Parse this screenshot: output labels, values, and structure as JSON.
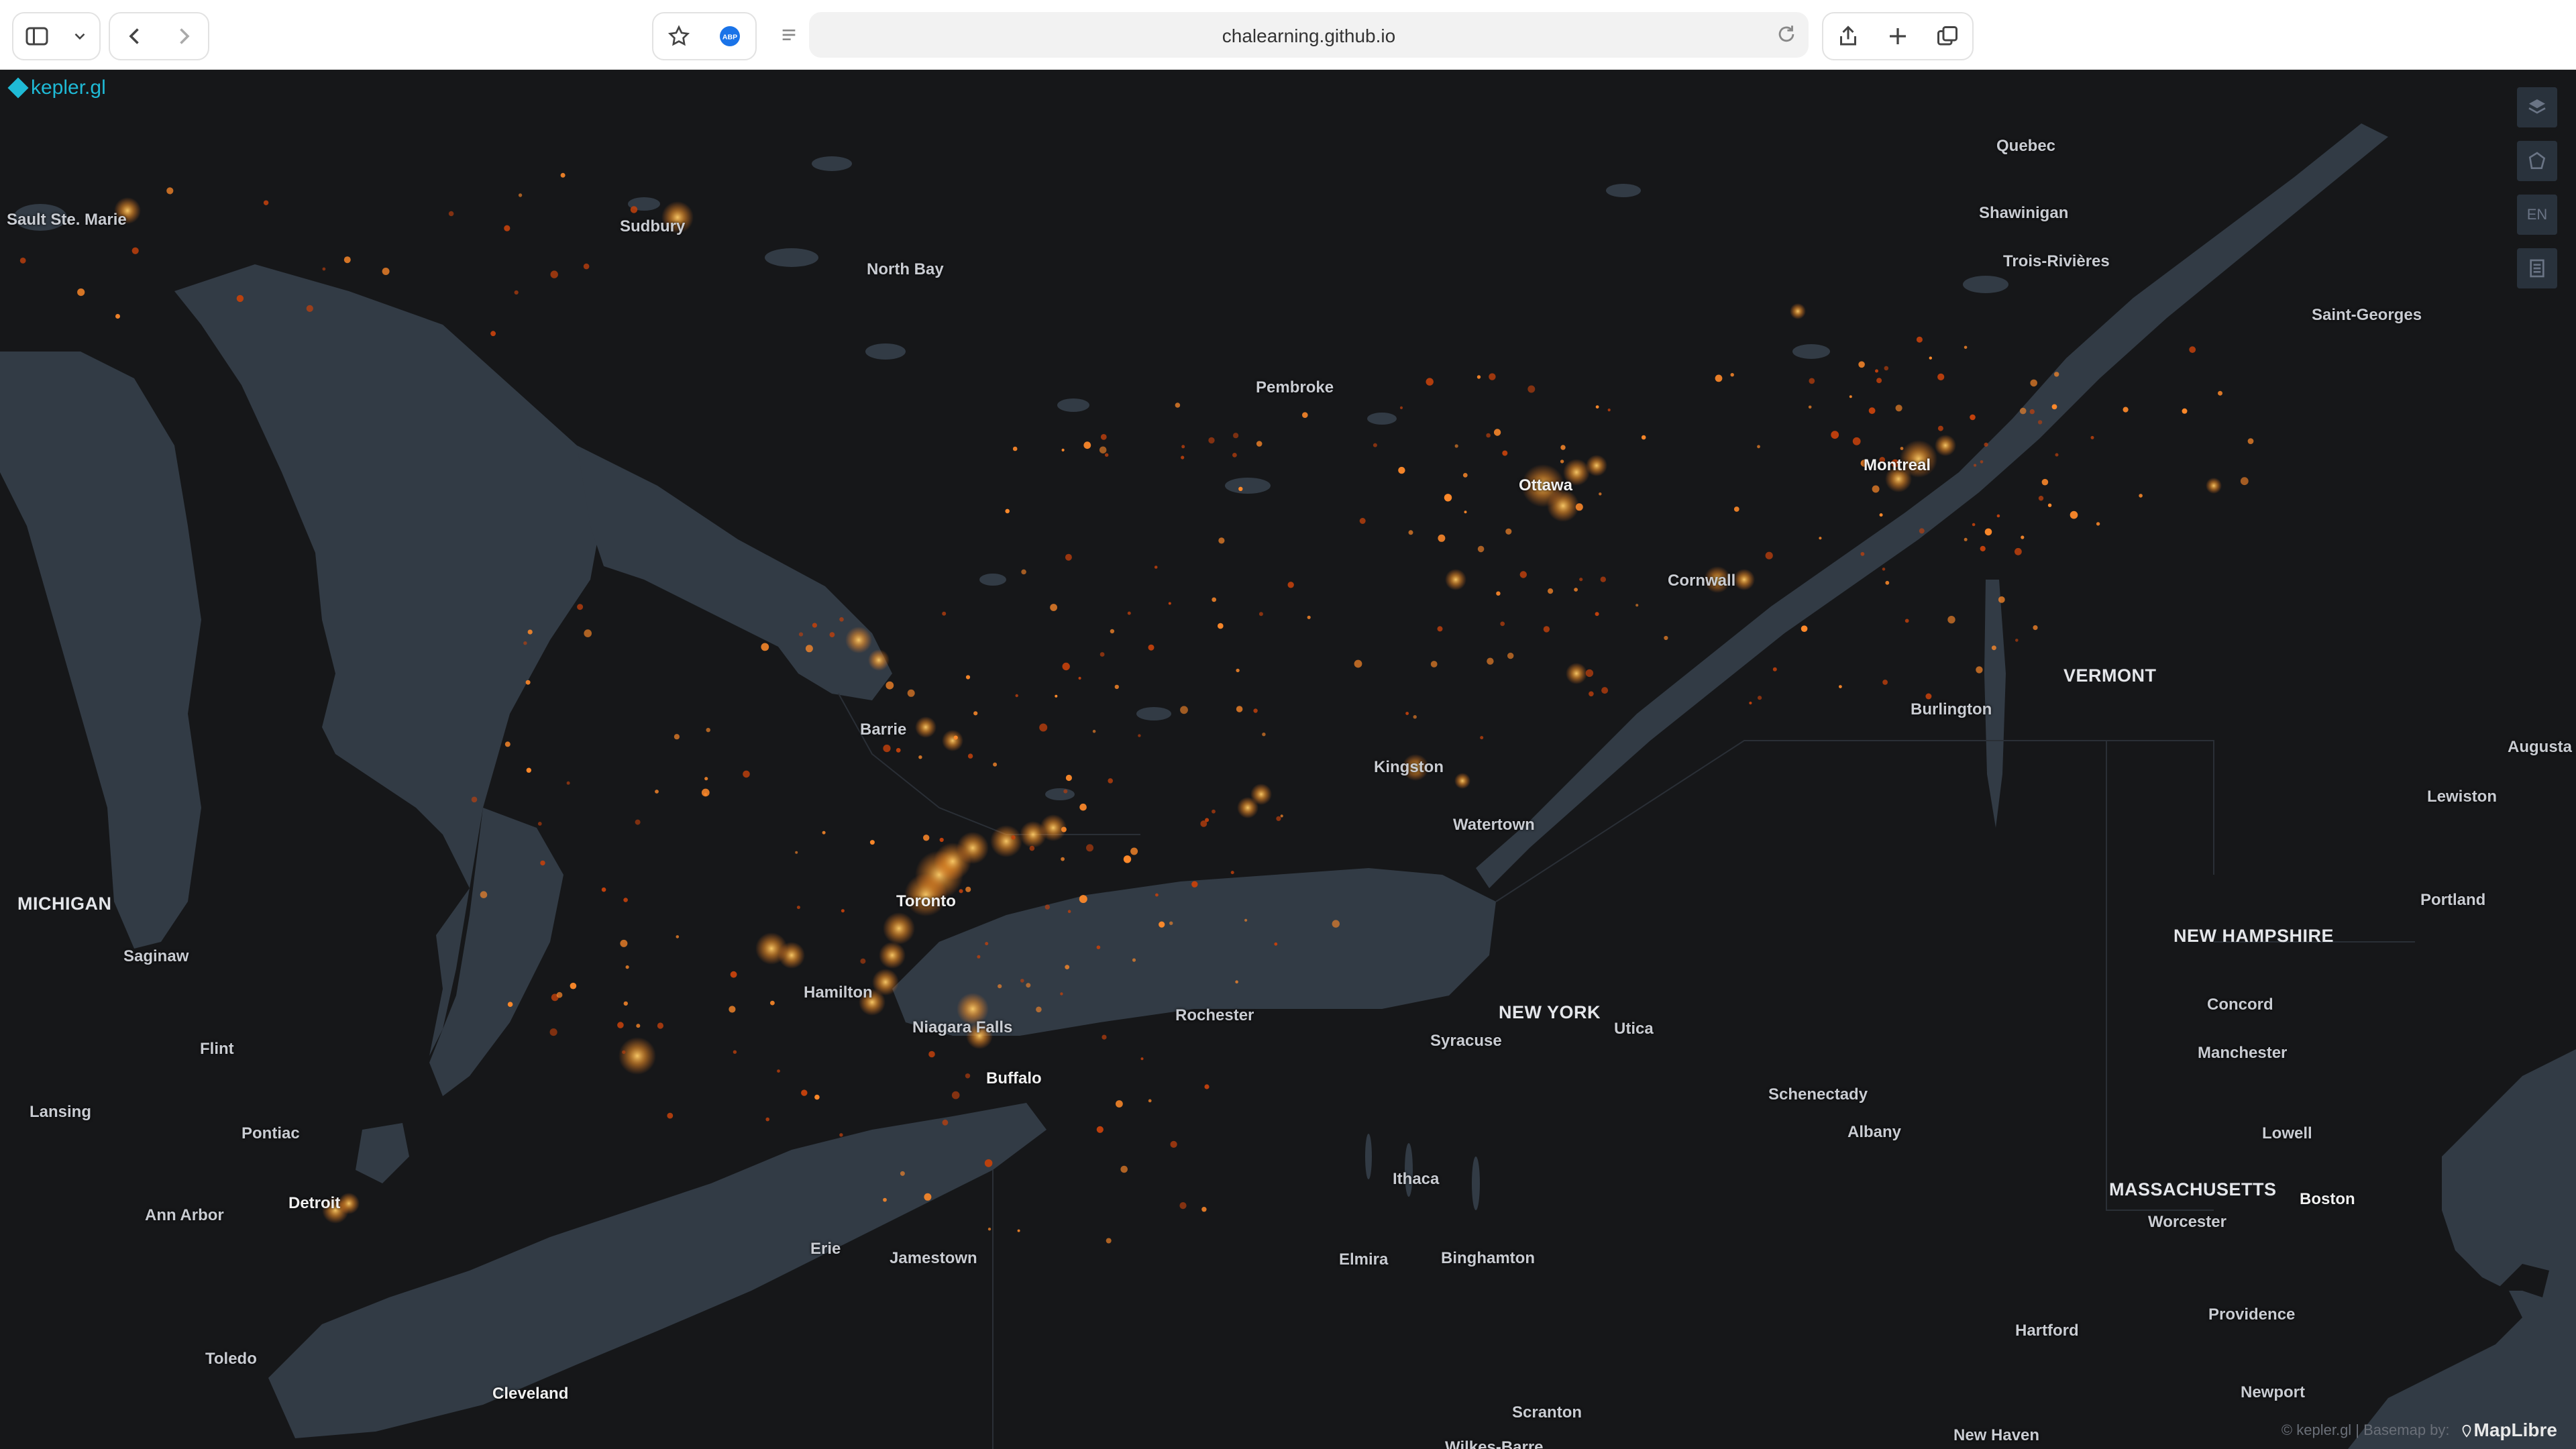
{
  "browser": {
    "url": "chalearning.github.io",
    "icons": [
      "sidebar-icon",
      "chevron-down-icon",
      "back-icon",
      "forward-icon",
      "star-icon",
      "abp-icon",
      "reader-icon",
      "reload-icon",
      "share-icon",
      "plus-icon",
      "tabs-icon"
    ],
    "abp_label": "ABP"
  },
  "app": {
    "logo_text": "kepler.gl",
    "lang_button": "EN",
    "accent_color": "#1fbad6"
  },
  "map": {
    "cities": [
      {
        "name": "Quebec",
        "key": "quebec"
      },
      {
        "name": "Sault Ste. Marie",
        "key": "sault"
      },
      {
        "name": "Sudbury",
        "key": "sudbury"
      },
      {
        "name": "North Bay",
        "key": "northbay"
      },
      {
        "name": "Shawinigan",
        "key": "shawinigan"
      },
      {
        "name": "Trois-Rivières",
        "key": "trois"
      },
      {
        "name": "Saint-Georges",
        "key": "stgeorges"
      },
      {
        "name": "Pembroke",
        "key": "pembroke"
      },
      {
        "name": "Montreal",
        "key": "montreal"
      },
      {
        "name": "Ottawa",
        "key": "ottawa"
      },
      {
        "name": "Cornwall",
        "key": "cornwall"
      },
      {
        "name": "Burlington",
        "key": "burlington"
      },
      {
        "name": "Barrie",
        "key": "barrie"
      },
      {
        "name": "Kingston",
        "key": "kingston"
      },
      {
        "name": "Augusta",
        "key": "augusta"
      },
      {
        "name": "Lewiston",
        "key": "lewiston"
      },
      {
        "name": "Watertown",
        "key": "watertown"
      },
      {
        "name": "Toronto",
        "key": "toronto"
      },
      {
        "name": "Portland",
        "key": "portland"
      },
      {
        "name": "Saginaw",
        "key": "saginaw"
      },
      {
        "name": "Hamilton",
        "key": "hamilton"
      },
      {
        "name": "Concord",
        "key": "concord"
      },
      {
        "name": "Rochester",
        "key": "rochester"
      },
      {
        "name": "Niagara Falls",
        "key": "niagara"
      },
      {
        "name": "Flint",
        "key": "flint"
      },
      {
        "name": "Syracuse",
        "key": "syracuse"
      },
      {
        "name": "Utica",
        "key": "utica"
      },
      {
        "name": "Manchester",
        "key": "manchester"
      },
      {
        "name": "Buffalo",
        "key": "buffalo"
      },
      {
        "name": "Schenectady",
        "key": "schenectady"
      },
      {
        "name": "Lansing",
        "key": "lansing"
      },
      {
        "name": "Albany",
        "key": "albany"
      },
      {
        "name": "Pontiac",
        "key": "pontiac"
      },
      {
        "name": "Lowell",
        "key": "lowell"
      },
      {
        "name": "Ithaca",
        "key": "ithaca"
      },
      {
        "name": "Detroit",
        "key": "detroit"
      },
      {
        "name": "Boston",
        "key": "boston"
      },
      {
        "name": "Ann Arbor",
        "key": "annarbor"
      },
      {
        "name": "Worcester",
        "key": "worcester"
      },
      {
        "name": "Erie",
        "key": "erie"
      },
      {
        "name": "Jamestown",
        "key": "jamestown"
      },
      {
        "name": "Elmira",
        "key": "elmira"
      },
      {
        "name": "Binghamton",
        "key": "binghamton"
      },
      {
        "name": "Providence",
        "key": "providence"
      },
      {
        "name": "Toledo",
        "key": "toledo"
      },
      {
        "name": "Hartford",
        "key": "hartford"
      },
      {
        "name": "Cleveland",
        "key": "cleveland"
      },
      {
        "name": "Newport",
        "key": "newport"
      },
      {
        "name": "Scranton",
        "key": "scranton"
      },
      {
        "name": "New Haven",
        "key": "newhaven"
      },
      {
        "name": "Wilkes-Barre",
        "key": "wilkesbarre"
      }
    ],
    "states": [
      {
        "name": "MICHIGAN",
        "key": "michigan"
      },
      {
        "name": "VERMONT",
        "key": "vermont"
      },
      {
        "name": "NEW HAMPSHIRE",
        "key": "nh"
      },
      {
        "name": "NEW YORK",
        "key": "ny"
      },
      {
        "name": "MASSACHUSETTS",
        "key": "ma"
      }
    ],
    "attribution": "© kepler.gl | Basemap by:",
    "maplibre": "MapLibre",
    "colors": {
      "land": "#161719",
      "water": "#323b45",
      "point_core": "#ffb63d",
      "point_glow": "#ff7a1a"
    }
  }
}
